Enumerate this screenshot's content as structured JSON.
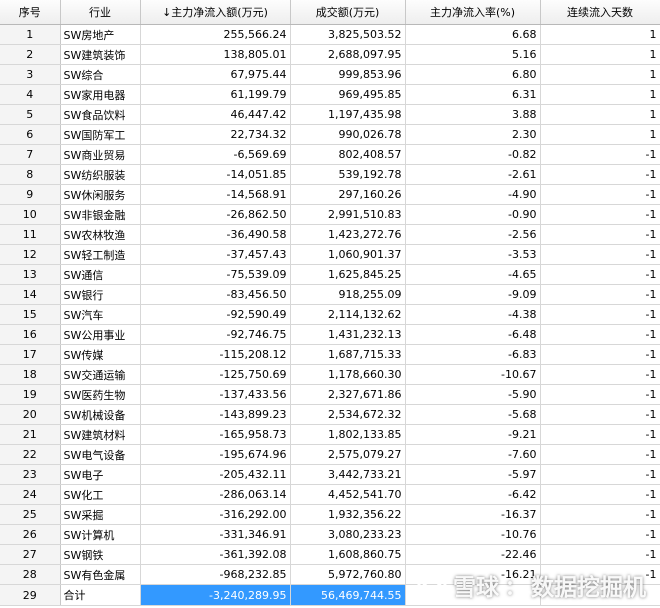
{
  "headers": {
    "index": "序号",
    "industry": "行业",
    "net_inflow": "↓主力净流入额(万元)",
    "turnover": "成交额(万元)",
    "inflow_rate": "主力净流入率(%)",
    "streak_days": "连续流入天数"
  },
  "rows": [
    {
      "index": "1",
      "industry": "SW房地产",
      "net_inflow": "255,566.24",
      "turnover": "3,825,503.52",
      "inflow_rate": "6.68",
      "streak_days": "1"
    },
    {
      "index": "2",
      "industry": "SW建筑装饰",
      "net_inflow": "138,805.01",
      "turnover": "2,688,097.95",
      "inflow_rate": "5.16",
      "streak_days": "1"
    },
    {
      "index": "3",
      "industry": "SW综合",
      "net_inflow": "67,975.44",
      "turnover": "999,853.96",
      "inflow_rate": "6.80",
      "streak_days": "1"
    },
    {
      "index": "4",
      "industry": "SW家用电器",
      "net_inflow": "61,199.79",
      "turnover": "969,495.85",
      "inflow_rate": "6.31",
      "streak_days": "1"
    },
    {
      "index": "5",
      "industry": "SW食品饮料",
      "net_inflow": "46,447.42",
      "turnover": "1,197,435.98",
      "inflow_rate": "3.88",
      "streak_days": "1"
    },
    {
      "index": "6",
      "industry": "SW国防军工",
      "net_inflow": "22,734.32",
      "turnover": "990,026.78",
      "inflow_rate": "2.30",
      "streak_days": "1"
    },
    {
      "index": "7",
      "industry": "SW商业贸易",
      "net_inflow": "-6,569.69",
      "turnover": "802,408.57",
      "inflow_rate": "-0.82",
      "streak_days": "-1"
    },
    {
      "index": "8",
      "industry": "SW纺织服装",
      "net_inflow": "-14,051.85",
      "turnover": "539,192.78",
      "inflow_rate": "-2.61",
      "streak_days": "-1"
    },
    {
      "index": "9",
      "industry": "SW休闲服务",
      "net_inflow": "-14,568.91",
      "turnover": "297,160.26",
      "inflow_rate": "-4.90",
      "streak_days": "-1"
    },
    {
      "index": "10",
      "industry": "SW非银金融",
      "net_inflow": "-26,862.50",
      "turnover": "2,991,510.83",
      "inflow_rate": "-0.90",
      "streak_days": "-1"
    },
    {
      "index": "11",
      "industry": "SW农林牧渔",
      "net_inflow": "-36,490.58",
      "turnover": "1,423,272.76",
      "inflow_rate": "-2.56",
      "streak_days": "-1"
    },
    {
      "index": "12",
      "industry": "SW轻工制造",
      "net_inflow": "-37,457.43",
      "turnover": "1,060,901.37",
      "inflow_rate": "-3.53",
      "streak_days": "-1"
    },
    {
      "index": "13",
      "industry": "SW通信",
      "net_inflow": "-75,539.09",
      "turnover": "1,625,845.25",
      "inflow_rate": "-4.65",
      "streak_days": "-1"
    },
    {
      "index": "14",
      "industry": "SW银行",
      "net_inflow": "-83,456.50",
      "turnover": "918,255.09",
      "inflow_rate": "-9.09",
      "streak_days": "-1"
    },
    {
      "index": "15",
      "industry": "SW汽车",
      "net_inflow": "-92,590.49",
      "turnover": "2,114,132.62",
      "inflow_rate": "-4.38",
      "streak_days": "-1"
    },
    {
      "index": "16",
      "industry": "SW公用事业",
      "net_inflow": "-92,746.75",
      "turnover": "1,431,232.13",
      "inflow_rate": "-6.48",
      "streak_days": "-1"
    },
    {
      "index": "17",
      "industry": "SW传媒",
      "net_inflow": "-115,208.12",
      "turnover": "1,687,715.33",
      "inflow_rate": "-6.83",
      "streak_days": "-1"
    },
    {
      "index": "18",
      "industry": "SW交通运输",
      "net_inflow": "-125,750.69",
      "turnover": "1,178,660.30",
      "inflow_rate": "-10.67",
      "streak_days": "-1"
    },
    {
      "index": "19",
      "industry": "SW医药生物",
      "net_inflow": "-137,433.56",
      "turnover": "2,327,671.86",
      "inflow_rate": "-5.90",
      "streak_days": "-1"
    },
    {
      "index": "20",
      "industry": "SW机械设备",
      "net_inflow": "-143,899.23",
      "turnover": "2,534,672.32",
      "inflow_rate": "-5.68",
      "streak_days": "-1"
    },
    {
      "index": "21",
      "industry": "SW建筑材料",
      "net_inflow": "-165,958.73",
      "turnover": "1,802,133.85",
      "inflow_rate": "-9.21",
      "streak_days": "-1"
    },
    {
      "index": "22",
      "industry": "SW电气设备",
      "net_inflow": "-195,674.96",
      "turnover": "2,575,079.27",
      "inflow_rate": "-7.60",
      "streak_days": "-1"
    },
    {
      "index": "23",
      "industry": "SW电子",
      "net_inflow": "-205,432.11",
      "turnover": "3,442,733.21",
      "inflow_rate": "-5.97",
      "streak_days": "-1"
    },
    {
      "index": "24",
      "industry": "SW化工",
      "net_inflow": "-286,063.14",
      "turnover": "4,452,541.70",
      "inflow_rate": "-6.42",
      "streak_days": "-1"
    },
    {
      "index": "25",
      "industry": "SW采掘",
      "net_inflow": "-316,292.00",
      "turnover": "1,932,356.22",
      "inflow_rate": "-16.37",
      "streak_days": "-1"
    },
    {
      "index": "26",
      "industry": "SW计算机",
      "net_inflow": "-331,346.91",
      "turnover": "3,080,233.23",
      "inflow_rate": "-10.76",
      "streak_days": "-1"
    },
    {
      "index": "27",
      "industry": "SW钢铁",
      "net_inflow": "-361,392.08",
      "turnover": "1,608,860.75",
      "inflow_rate": "-22.46",
      "streak_days": "-1"
    },
    {
      "index": "28",
      "industry": "SW有色金属",
      "net_inflow": "-968,232.85",
      "turnover": "5,972,760.80",
      "inflow_rate": "-16.21",
      "streak_days": "-1"
    }
  ],
  "total": {
    "index": "29",
    "label": "合计",
    "net_inflow": "-3,240,289.95",
    "turnover": "56,469,744.55",
    "inflow_rate": "",
    "streak_days": ""
  },
  "watermark": {
    "brand": "雪球",
    "separator": "：",
    "author": "数据挖掘机",
    "logo_icon": "snowball-logo-icon"
  },
  "colors": {
    "selection": "#3399ff",
    "header_bg": "#eeeeee",
    "grid_line": "#d7d7d7"
  }
}
